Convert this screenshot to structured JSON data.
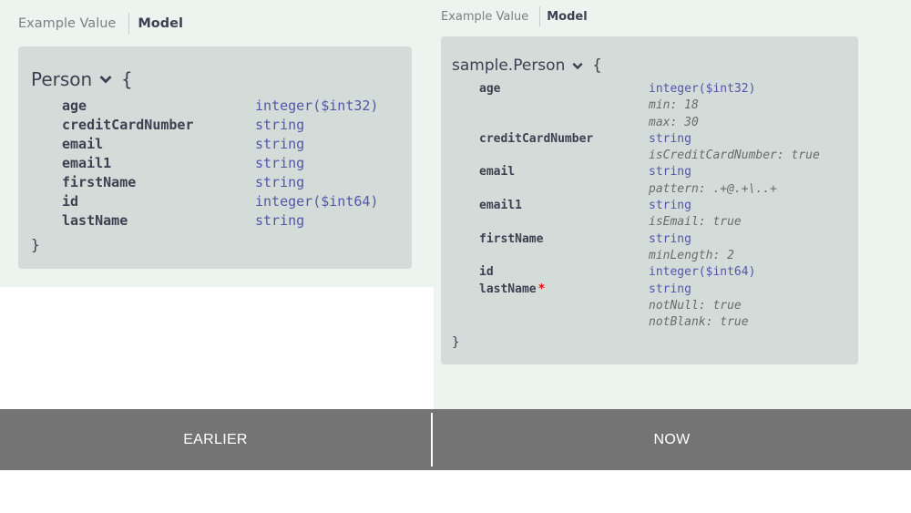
{
  "earlier": {
    "tabs": {
      "example_value": "Example Value",
      "model": "Model"
    },
    "model_name": "Person",
    "open_brace": "{",
    "close_brace": "}",
    "properties": [
      {
        "name": "age",
        "type": "integer($int32)"
      },
      {
        "name": "creditCardNumber",
        "type": "string"
      },
      {
        "name": "email",
        "type": "string"
      },
      {
        "name": "email1",
        "type": "string"
      },
      {
        "name": "firstName",
        "type": "string"
      },
      {
        "name": "id",
        "type": "integer($int64)"
      },
      {
        "name": "lastName",
        "type": "string"
      }
    ]
  },
  "now": {
    "tabs": {
      "example_value": "Example Value",
      "model": "Model"
    },
    "model_name": "sample.Person",
    "open_brace": "{",
    "close_brace": "}",
    "required_marker": "*",
    "properties": [
      {
        "name": "age",
        "type": "integer($int32)",
        "constraints": [
          "min: 18",
          "max: 30"
        ]
      },
      {
        "name": "creditCardNumber",
        "type": "string",
        "constraints": [
          "isCreditCardNumber: true"
        ]
      },
      {
        "name": "email",
        "type": "string",
        "constraints": [
          "pattern: .+@.+\\..+"
        ]
      },
      {
        "name": "email1",
        "type": "string",
        "constraints": [
          "isEmail: true"
        ]
      },
      {
        "name": "firstName",
        "type": "string",
        "constraints": [
          "minLength: 2"
        ]
      },
      {
        "name": "id",
        "type": "integer($int64)",
        "constraints": []
      },
      {
        "name": "lastName",
        "type": "string",
        "required": true,
        "constraints": [
          "notNull: true",
          "notBlank: true"
        ]
      }
    ]
  },
  "comparison_bar": {
    "left_label": "EARLIER",
    "right_label": "NOW"
  },
  "colors": {
    "panel_background": "#ebf4ef",
    "model_box_background": "#d3dcd8",
    "property_name": "#3b4151",
    "type_text": "#5555aa",
    "constraint_text": "#6b6b6b",
    "required_marker": "#e01010",
    "bar_background": "#747474"
  },
  "icons": {
    "expand": "chevron-down-icon"
  }
}
